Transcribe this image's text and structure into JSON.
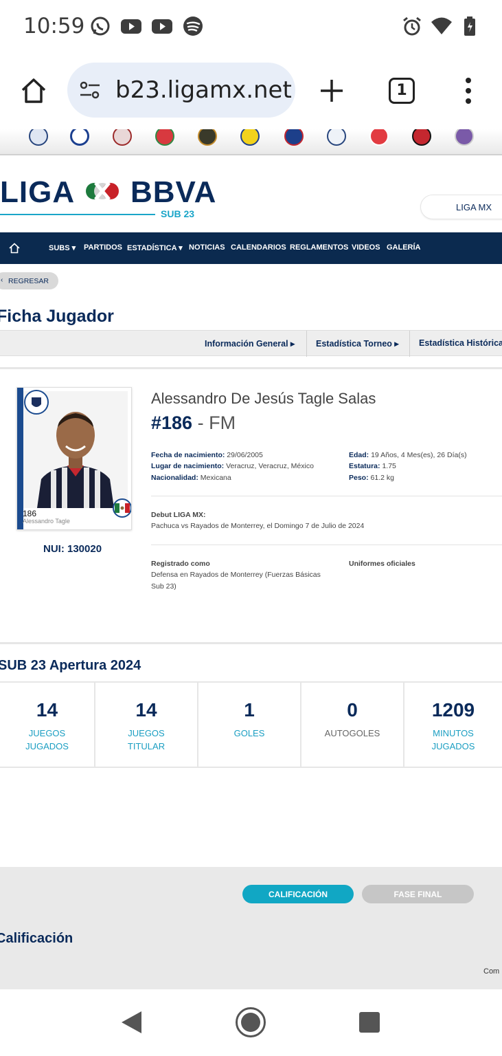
{
  "status_bar": {
    "time": "10:59",
    "icons": [
      "whatsapp-icon",
      "youtube-icon",
      "youtube-icon",
      "spotify-icon",
      "alarm-icon",
      "wifi-icon",
      "battery-icon"
    ]
  },
  "browser": {
    "url": "b23.ligamx.net",
    "tab_count": "1"
  },
  "site": {
    "brand_left": "LIGA",
    "brand_right": "BBVA",
    "brand_sub": "SUB 23",
    "liga_mx_button": "LIGA MX"
  },
  "nav": {
    "items": [
      "SUBS",
      "PARTIDOS",
      "ESTADÍSTICA",
      "NOTICIAS",
      "CALENDARIOS",
      "REGLAMENTOS",
      "VIDEOS",
      "GALERÍA"
    ]
  },
  "page": {
    "back_label": "REGRESAR",
    "title": "Ficha Jugador",
    "tabs": [
      "Información General",
      "Estadística Torneo",
      "Estadística Histórica"
    ]
  },
  "player": {
    "card_number": "186",
    "card_name": "Alessandro Tagle",
    "nui": "NUI: 130020",
    "full_name": "Alessandro De Jesús Tagle Salas",
    "number": "#186",
    "separator": " - ",
    "position": "FM",
    "birth_label": "Fecha de nacimiento:",
    "birth_value": "29/06/2005",
    "birthplace_label": "Lugar de nacimiento:",
    "birthplace_value": "Veracruz, Veracruz, México",
    "nationality_label": "Nacionalidad:",
    "nationality_value": "Mexicana",
    "age_label": "Edad:",
    "age_value": "19 Años, 4 Mes(es), 26 Día(s)",
    "height_label": "Estatura:",
    "height_value": "1.75",
    "weight_label": "Peso:",
    "weight_value": "61.2 kg",
    "debut_label": "Debut LIGA MX:",
    "debut_value": "Pachuca vs Rayados de Monterrey, el Domingo 7 de Julio de 2024",
    "registered_label": "Registrado como",
    "registered_value_1": "Defensa en Rayados de Monterrey (Fuerzas Básicas",
    "registered_value_2": "Sub 23)",
    "uniforms_label": "Uniformes oficiales"
  },
  "tournament": {
    "title": "SUB 23 Apertura 2024",
    "stats": [
      {
        "value": "14",
        "label_1": "JUEGOS",
        "label_2": "JUGADOS"
      },
      {
        "value": "14",
        "label_1": "JUEGOS",
        "label_2": "TITULAR"
      },
      {
        "value": "1",
        "label_1": "GOLES",
        "label_2": ""
      },
      {
        "value": "0",
        "label_1": "AUTOGOLES",
        "label_2": ""
      },
      {
        "value": "1209",
        "label_1": "MINUTOS",
        "label_2": "JUGADOS"
      }
    ]
  },
  "calificacion": {
    "pill_active": "CALIFICACIÓN",
    "pill_inactive": "FASE FINAL",
    "title": "Calificación",
    "trailing": "Com",
    "colors": {
      "active": "#11a7c4",
      "inactive": "#c6c6c6"
    }
  },
  "colors": {
    "navy": "#0b2a4f",
    "cyan": "#1a9ec2"
  }
}
